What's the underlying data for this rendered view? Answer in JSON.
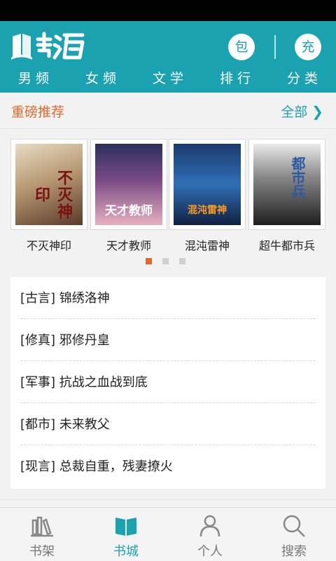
{
  "app": {
    "logo_text": "书海"
  },
  "header": {
    "btn_bao": "包",
    "btn_chong": "充",
    "tabs": [
      "男频",
      "女频",
      "文学",
      "排行",
      "分类"
    ]
  },
  "featured": {
    "title": "重磅推荐",
    "more_label": "全部",
    "books": [
      {
        "title": "不灭神印",
        "cover_text": "不灭神印"
      },
      {
        "title": "天才教师",
        "cover_text": "天才教师"
      },
      {
        "title": "混沌雷神",
        "cover_text": "混沌雷神"
      },
      {
        "title": "超牛都市兵",
        "cover_text": "都市兵"
      }
    ],
    "page_count": 3,
    "active_page": 1
  },
  "list": [
    {
      "tag": "[古言]",
      "title": "锦绣洛神"
    },
    {
      "tag": "[修真]",
      "title": "邪修丹皇"
    },
    {
      "tag": "[军事]",
      "title": "抗战之血战到底"
    },
    {
      "tag": "[都市]",
      "title": "未来教父"
    },
    {
      "tag": "[现言]",
      "title": "总裁自重，残妻撩火"
    }
  ],
  "bottom_nav": [
    {
      "label": "书架",
      "icon": "bookshelf-icon",
      "active": false
    },
    {
      "label": "书城",
      "icon": "book-store-icon",
      "active": true
    },
    {
      "label": "个人",
      "icon": "person-icon",
      "active": false
    },
    {
      "label": "搜索",
      "icon": "search-icon",
      "active": false
    }
  ],
  "colors": {
    "primary": "#1aa2b0",
    "accent": "#e06a2d",
    "inactive": "#777777"
  }
}
